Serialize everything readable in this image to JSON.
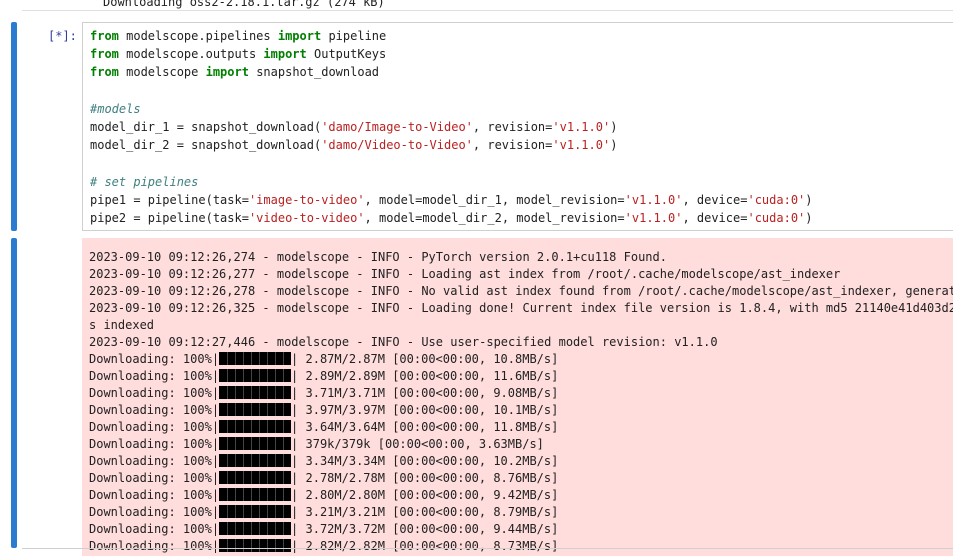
{
  "prev_output": {
    "text": "Downloading oss2-2.18.1.tar.gz (274 kB)"
  },
  "code_cell": {
    "prompt": "[*]:",
    "lines": [
      [
        {
          "t": "from",
          "c": "kw"
        },
        {
          "t": " modelscope.pipelines ",
          "c": ""
        },
        {
          "t": "import",
          "c": "kw"
        },
        {
          "t": " pipeline",
          "c": ""
        }
      ],
      [
        {
          "t": "from",
          "c": "kw"
        },
        {
          "t": " modelscope.outputs ",
          "c": ""
        },
        {
          "t": "import",
          "c": "kw"
        },
        {
          "t": " OutputKeys",
          "c": ""
        }
      ],
      [
        {
          "t": "from",
          "c": "kw"
        },
        {
          "t": " modelscope ",
          "c": ""
        },
        {
          "t": "import",
          "c": "kw"
        },
        {
          "t": " snapshot_download",
          "c": ""
        }
      ],
      [],
      [
        {
          "t": "#models",
          "c": "cm"
        }
      ],
      [
        {
          "t": "model_dir_1 = snapshot_download(",
          "c": ""
        },
        {
          "t": "'damo/Image-to-Video'",
          "c": "str"
        },
        {
          "t": ", revision=",
          "c": ""
        },
        {
          "t": "'v1.1.0'",
          "c": "str"
        },
        {
          "t": ")",
          "c": ""
        }
      ],
      [
        {
          "t": "model_dir_2 = snapshot_download(",
          "c": ""
        },
        {
          "t": "'damo/Video-to-Video'",
          "c": "str"
        },
        {
          "t": ", revision=",
          "c": ""
        },
        {
          "t": "'v1.1.0'",
          "c": "str"
        },
        {
          "t": ")",
          "c": ""
        }
      ],
      [],
      [
        {
          "t": "# set pipelines",
          "c": "cm"
        }
      ],
      [
        {
          "t": "pipe1 = pipeline(task=",
          "c": ""
        },
        {
          "t": "'image-to-video'",
          "c": "str"
        },
        {
          "t": ", model=model_dir_1, model_revision=",
          "c": ""
        },
        {
          "t": "'v1.1.0'",
          "c": "str"
        },
        {
          "t": ", device=",
          "c": ""
        },
        {
          "t": "'cuda:0'",
          "c": "str"
        },
        {
          "t": ")",
          "c": ""
        }
      ],
      [
        {
          "t": "pipe2 = pipeline(task=",
          "c": ""
        },
        {
          "t": "'video-to-video'",
          "c": "str"
        },
        {
          "t": ", model=model_dir_2, model_revision=",
          "c": ""
        },
        {
          "t": "'v1.1.0'",
          "c": "str"
        },
        {
          "t": ", device=",
          "c": ""
        },
        {
          "t": "'cuda:0'",
          "c": "str"
        },
        {
          "t": ")",
          "c": ""
        }
      ]
    ]
  },
  "output": {
    "log_lines": [
      "2023-09-10 09:12:26,274 - modelscope - INFO - PyTorch version 2.0.1+cu118 Found.",
      "2023-09-10 09:12:26,277 - modelscope - INFO - Loading ast index from /root/.cache/modelscope/ast_indexer",
      "2023-09-10 09:12:26,278 - modelscope - INFO - No valid ast index found from /root/.cache/modelscope/ast_indexer, generati",
      "2023-09-10 09:12:26,325 - modelscope - INFO - Loading done! Current index file version is 1.8.4, with md5 21140e41d403d24",
      "s indexed",
      "2023-09-10 09:12:27,446 - modelscope - INFO - Use user-specified model revision: v1.1.0"
    ],
    "downloads": [
      {
        "label": "Downloading: 100%|",
        "progress": 1.0,
        "info": "| 2.87M/2.87M [00:00<00:00, 10.8MB/s]"
      },
      {
        "label": "Downloading: 100%|",
        "progress": 1.0,
        "info": "| 2.89M/2.89M [00:00<00:00, 11.6MB/s]"
      },
      {
        "label": "Downloading: 100%|",
        "progress": 1.0,
        "info": "| 3.71M/3.71M [00:00<00:00, 9.08MB/s]"
      },
      {
        "label": "Downloading: 100%|",
        "progress": 1.0,
        "info": "| 3.97M/3.97M [00:00<00:00, 10.1MB/s]"
      },
      {
        "label": "Downloading: 100%|",
        "progress": 1.0,
        "info": "| 3.64M/3.64M [00:00<00:00, 11.8MB/s]"
      },
      {
        "label": "Downloading: 100%|",
        "progress": 1.0,
        "info": "| 379k/379k [00:00<00:00, 3.63MB/s]"
      },
      {
        "label": "Downloading: 100%|",
        "progress": 1.0,
        "info": "| 3.34M/3.34M [00:00<00:00, 10.2MB/s]"
      },
      {
        "label": "Downloading: 100%|",
        "progress": 1.0,
        "info": "| 2.78M/2.78M [00:00<00:00, 8.76MB/s]"
      },
      {
        "label": "Downloading: 100%|",
        "progress": 1.0,
        "info": "| 2.80M/2.80M [00:00<00:00, 9.42MB/s]"
      },
      {
        "label": "Downloading: 100%|",
        "progress": 1.0,
        "info": "| 3.21M/3.21M [00:00<00:00, 8.79MB/s]"
      },
      {
        "label": "Downloading: 100%|",
        "progress": 1.0,
        "info": "| 3.72M/3.72M [00:00<00:00, 9.44MB/s]"
      },
      {
        "label": "Downloading: 100%|",
        "progress": 1.0,
        "info": "| 2.82M/2.82M [00:00<00:00, 8.73MB/s]"
      }
    ]
  },
  "colors": {
    "cell_bar": "#2b7bd0",
    "prompt": "#303f9f",
    "output_bg": "#ffdddd",
    "keyword": "#008000",
    "string": "#ba2121",
    "comment": "#408080"
  }
}
